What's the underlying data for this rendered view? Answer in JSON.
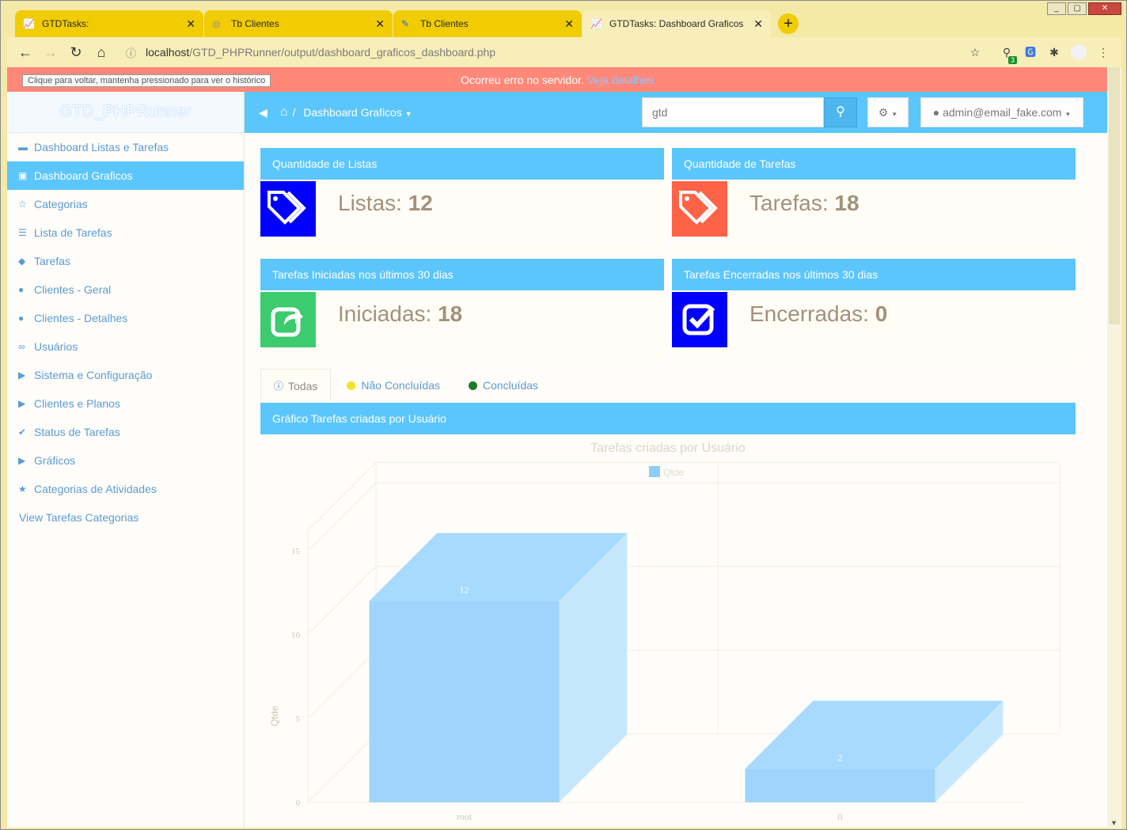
{
  "browser": {
    "tabs": [
      {
        "label": "GTDTasks:",
        "icon": "chart-favicon"
      },
      {
        "label": "Tb Clientes",
        "icon": "globe-favicon"
      },
      {
        "label": "Tb Clientes",
        "icon": "python-favicon"
      },
      {
        "label": "GTDTasks: Dashboard Graficos",
        "icon": "chart-favicon"
      }
    ],
    "url_host": "localhost",
    "url_path": "/GTD_PHPRunner/output/dashboard_graficos_dashboard.php",
    "extension_badge": "3",
    "back_tooltip": "Clique para voltar, mantenha pressionado para ver o histórico"
  },
  "error_bar": {
    "message": "Ocorreu erro no servidor.",
    "link": "Veja detalhes"
  },
  "sidebar": {
    "brand": "GTD_PHPRunner",
    "items": [
      {
        "label": "Dashboard Listas e Tarefas",
        "icon": "dashboard-icon",
        "active": false
      },
      {
        "label": "Dashboard Graficos",
        "icon": "dashboard-icon",
        "active": true
      },
      {
        "label": "Categorias",
        "icon": "star-outline-icon",
        "active": false
      },
      {
        "label": "Lista de Tarefas",
        "icon": "list-icon",
        "active": false
      },
      {
        "label": "Tarefas",
        "icon": "tags-icon",
        "active": false
      },
      {
        "label": "Clientes - Geral",
        "icon": "user-icon",
        "active": false
      },
      {
        "label": "Clientes - Detalhes",
        "icon": "user-icon",
        "active": false
      },
      {
        "label": "Usuários",
        "icon": "glasses-icon",
        "active": false
      },
      {
        "label": "Sistema e Configuração",
        "icon": "caret-right-icon",
        "active": false
      },
      {
        "label": "Clientes e Planos",
        "icon": "caret-right-icon",
        "active": false
      },
      {
        "label": "Status de Tarefas",
        "icon": "check-icon",
        "active": false
      },
      {
        "label": "Gráficos",
        "icon": "caret-right-icon",
        "active": false
      },
      {
        "label": "Categorias de Atividades",
        "icon": "star-icon",
        "active": false
      },
      {
        "label": "View Tarefas Categorias",
        "icon": "",
        "active": false
      }
    ]
  },
  "header": {
    "breadcrumb": "Dashboard Graficos",
    "search_value": "gtd",
    "user": "admin@email_fake.com"
  },
  "cards": [
    {
      "title": "Quantidade de Listas",
      "label": "Listas:",
      "value": "12",
      "color": "#0000ff",
      "icon": "tags-icon"
    },
    {
      "title": "Quantidade de Tarefas",
      "label": "Tarefas:",
      "value": "18",
      "color": "#ff6347",
      "icon": "tags-icon"
    },
    {
      "title": "Tarefas Iniciadas nos últimos 30 dias",
      "label": "Iniciadas:",
      "value": "18",
      "color": "#3ccb6e",
      "icon": "share-icon"
    },
    {
      "title": "Tarefas Encerradas nos últimos 30 dias",
      "label": "Encerradas:",
      "value": "0",
      "color": "#0000ff",
      "icon": "checkbox-icon"
    }
  ],
  "chart_tabs": [
    {
      "label": "Todas",
      "icon": "info-icon",
      "active": true
    },
    {
      "label": "Não Concluídas",
      "icon": "yellow-dot",
      "color": "#f5e12c",
      "active": false
    },
    {
      "label": "Concluídas",
      "icon": "green-dot",
      "color": "#1f7a2a",
      "active": false
    }
  ],
  "chart_panel_title": "Gráfico Tarefas criadas por Usuário",
  "chart_data": {
    "type": "bar",
    "title": "Tarefas criadas por Usuário",
    "categories": [
      "root",
      "0"
    ],
    "series": [
      {
        "name": "Qtde",
        "values": [
          12,
          2
        ],
        "color": "#8ecdfc"
      }
    ],
    "xlabel": "",
    "ylabel": "Qtde",
    "ylim": [
      0,
      15
    ],
    "yticks": [
      0,
      5,
      10,
      15
    ],
    "grid": true,
    "legend": "top-center",
    "style": "3d"
  }
}
